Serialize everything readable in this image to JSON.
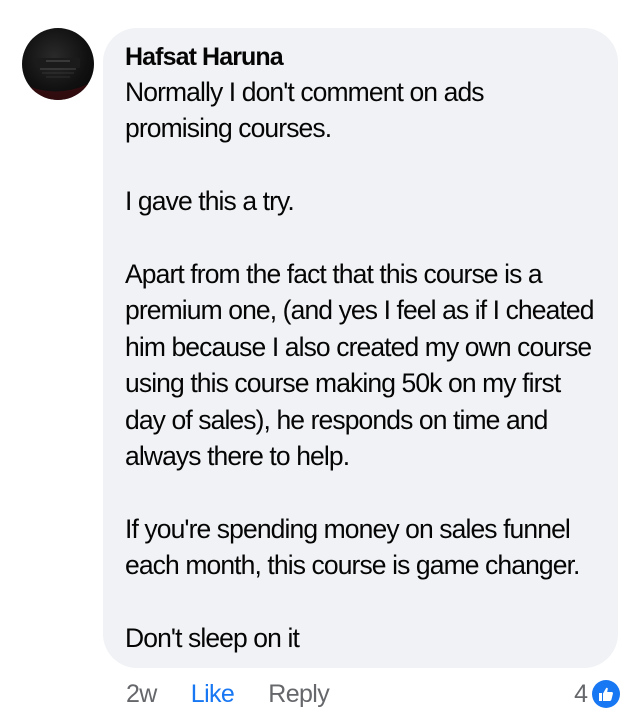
{
  "comment": {
    "author": "Hafsat Haruna",
    "paragraphs": [
      "Normally I don't comment on ads promising courses.",
      "I gave this a try.",
      "Apart from the fact that this course is a premium one, (and yes I feel as if I cheated him because I also created my own course using this course making 50k on my first day of sales), he responds on time and always there to help.",
      "If you're spending money on sales funnel each month, this course is game changer.",
      "Don't sleep on it"
    ],
    "timestamp": "2w",
    "like_label": "Like",
    "reply_label": "Reply",
    "reaction_count": "4",
    "reaction_icon": "like-icon"
  },
  "colors": {
    "bubble": "#f0f2f5",
    "text": "#050505",
    "secondary": "#65676b",
    "accent": "#1877f2"
  }
}
